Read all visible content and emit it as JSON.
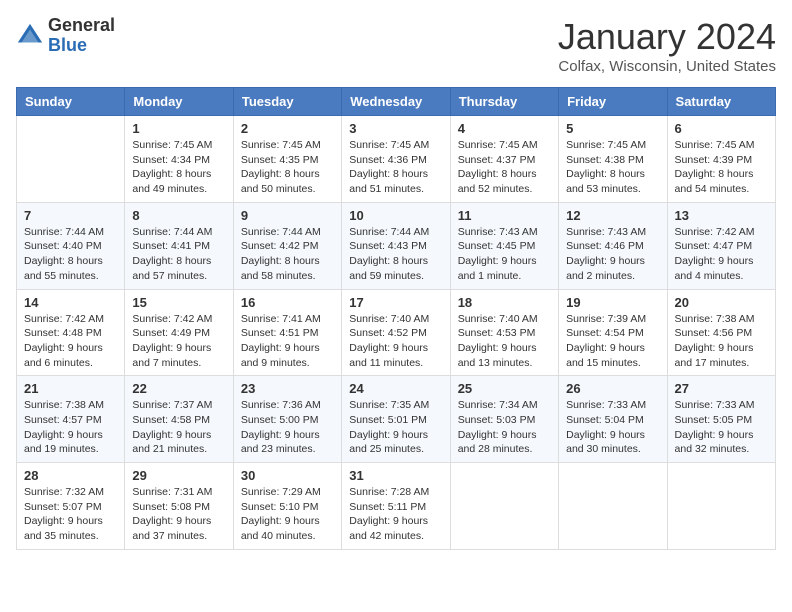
{
  "header": {
    "logo_general": "General",
    "logo_blue": "Blue",
    "month_year": "January 2024",
    "location": "Colfax, Wisconsin, United States"
  },
  "weekdays": [
    "Sunday",
    "Monday",
    "Tuesday",
    "Wednesday",
    "Thursday",
    "Friday",
    "Saturday"
  ],
  "weeks": [
    [
      {
        "day": "",
        "info": ""
      },
      {
        "day": "1",
        "info": "Sunrise: 7:45 AM\nSunset: 4:34 PM\nDaylight: 8 hours\nand 49 minutes."
      },
      {
        "day": "2",
        "info": "Sunrise: 7:45 AM\nSunset: 4:35 PM\nDaylight: 8 hours\nand 50 minutes."
      },
      {
        "day": "3",
        "info": "Sunrise: 7:45 AM\nSunset: 4:36 PM\nDaylight: 8 hours\nand 51 minutes."
      },
      {
        "day": "4",
        "info": "Sunrise: 7:45 AM\nSunset: 4:37 PM\nDaylight: 8 hours\nand 52 minutes."
      },
      {
        "day": "5",
        "info": "Sunrise: 7:45 AM\nSunset: 4:38 PM\nDaylight: 8 hours\nand 53 minutes."
      },
      {
        "day": "6",
        "info": "Sunrise: 7:45 AM\nSunset: 4:39 PM\nDaylight: 8 hours\nand 54 minutes."
      }
    ],
    [
      {
        "day": "7",
        "info": "Sunrise: 7:44 AM\nSunset: 4:40 PM\nDaylight: 8 hours\nand 55 minutes."
      },
      {
        "day": "8",
        "info": "Sunrise: 7:44 AM\nSunset: 4:41 PM\nDaylight: 8 hours\nand 57 minutes."
      },
      {
        "day": "9",
        "info": "Sunrise: 7:44 AM\nSunset: 4:42 PM\nDaylight: 8 hours\nand 58 minutes."
      },
      {
        "day": "10",
        "info": "Sunrise: 7:44 AM\nSunset: 4:43 PM\nDaylight: 8 hours\nand 59 minutes."
      },
      {
        "day": "11",
        "info": "Sunrise: 7:43 AM\nSunset: 4:45 PM\nDaylight: 9 hours\nand 1 minute."
      },
      {
        "day": "12",
        "info": "Sunrise: 7:43 AM\nSunset: 4:46 PM\nDaylight: 9 hours\nand 2 minutes."
      },
      {
        "day": "13",
        "info": "Sunrise: 7:42 AM\nSunset: 4:47 PM\nDaylight: 9 hours\nand 4 minutes."
      }
    ],
    [
      {
        "day": "14",
        "info": "Sunrise: 7:42 AM\nSunset: 4:48 PM\nDaylight: 9 hours\nand 6 minutes."
      },
      {
        "day": "15",
        "info": "Sunrise: 7:42 AM\nSunset: 4:49 PM\nDaylight: 9 hours\nand 7 minutes."
      },
      {
        "day": "16",
        "info": "Sunrise: 7:41 AM\nSunset: 4:51 PM\nDaylight: 9 hours\nand 9 minutes."
      },
      {
        "day": "17",
        "info": "Sunrise: 7:40 AM\nSunset: 4:52 PM\nDaylight: 9 hours\nand 11 minutes."
      },
      {
        "day": "18",
        "info": "Sunrise: 7:40 AM\nSunset: 4:53 PM\nDaylight: 9 hours\nand 13 minutes."
      },
      {
        "day": "19",
        "info": "Sunrise: 7:39 AM\nSunset: 4:54 PM\nDaylight: 9 hours\nand 15 minutes."
      },
      {
        "day": "20",
        "info": "Sunrise: 7:38 AM\nSunset: 4:56 PM\nDaylight: 9 hours\nand 17 minutes."
      }
    ],
    [
      {
        "day": "21",
        "info": "Sunrise: 7:38 AM\nSunset: 4:57 PM\nDaylight: 9 hours\nand 19 minutes."
      },
      {
        "day": "22",
        "info": "Sunrise: 7:37 AM\nSunset: 4:58 PM\nDaylight: 9 hours\nand 21 minutes."
      },
      {
        "day": "23",
        "info": "Sunrise: 7:36 AM\nSunset: 5:00 PM\nDaylight: 9 hours\nand 23 minutes."
      },
      {
        "day": "24",
        "info": "Sunrise: 7:35 AM\nSunset: 5:01 PM\nDaylight: 9 hours\nand 25 minutes."
      },
      {
        "day": "25",
        "info": "Sunrise: 7:34 AM\nSunset: 5:03 PM\nDaylight: 9 hours\nand 28 minutes."
      },
      {
        "day": "26",
        "info": "Sunrise: 7:33 AM\nSunset: 5:04 PM\nDaylight: 9 hours\nand 30 minutes."
      },
      {
        "day": "27",
        "info": "Sunrise: 7:33 AM\nSunset: 5:05 PM\nDaylight: 9 hours\nand 32 minutes."
      }
    ],
    [
      {
        "day": "28",
        "info": "Sunrise: 7:32 AM\nSunset: 5:07 PM\nDaylight: 9 hours\nand 35 minutes."
      },
      {
        "day": "29",
        "info": "Sunrise: 7:31 AM\nSunset: 5:08 PM\nDaylight: 9 hours\nand 37 minutes."
      },
      {
        "day": "30",
        "info": "Sunrise: 7:29 AM\nSunset: 5:10 PM\nDaylight: 9 hours\nand 40 minutes."
      },
      {
        "day": "31",
        "info": "Sunrise: 7:28 AM\nSunset: 5:11 PM\nDaylight: 9 hours\nand 42 minutes."
      },
      {
        "day": "",
        "info": ""
      },
      {
        "day": "",
        "info": ""
      },
      {
        "day": "",
        "info": ""
      }
    ]
  ]
}
